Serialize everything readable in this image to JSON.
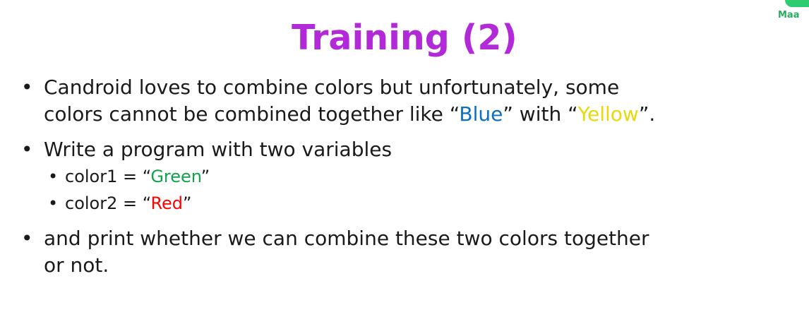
{
  "logo": {
    "text": "Maa"
  },
  "title": "Training (2)",
  "bullets": {
    "b1": {
      "line1": "Candroid loves to combine colors but unfortunately, some",
      "line2_pre": "colors cannot be combined together like “",
      "blue": "Blue",
      "line2_mid": "” with “",
      "yellow": "Yellow",
      "line2_post": "”."
    },
    "b2": {
      "text": "Write a program with two variables"
    },
    "sub1": {
      "pre": "color1 = “",
      "value": "Green",
      "post": "”"
    },
    "sub2": {
      "pre": "color2 = “",
      "value": "Red",
      "post": "”"
    },
    "b3": {
      "line1": "and print whether we can combine these two colors together",
      "line2": "or not."
    }
  },
  "colors": {
    "title": "#b22ad8",
    "blue": "#0b6fc4",
    "yellow": "#e8d80e",
    "green": "#10a34a",
    "red": "#ff0000"
  },
  "icons": {
    "bullet": "bullet-dot-icon",
    "logo": "logo-mark-icon"
  }
}
